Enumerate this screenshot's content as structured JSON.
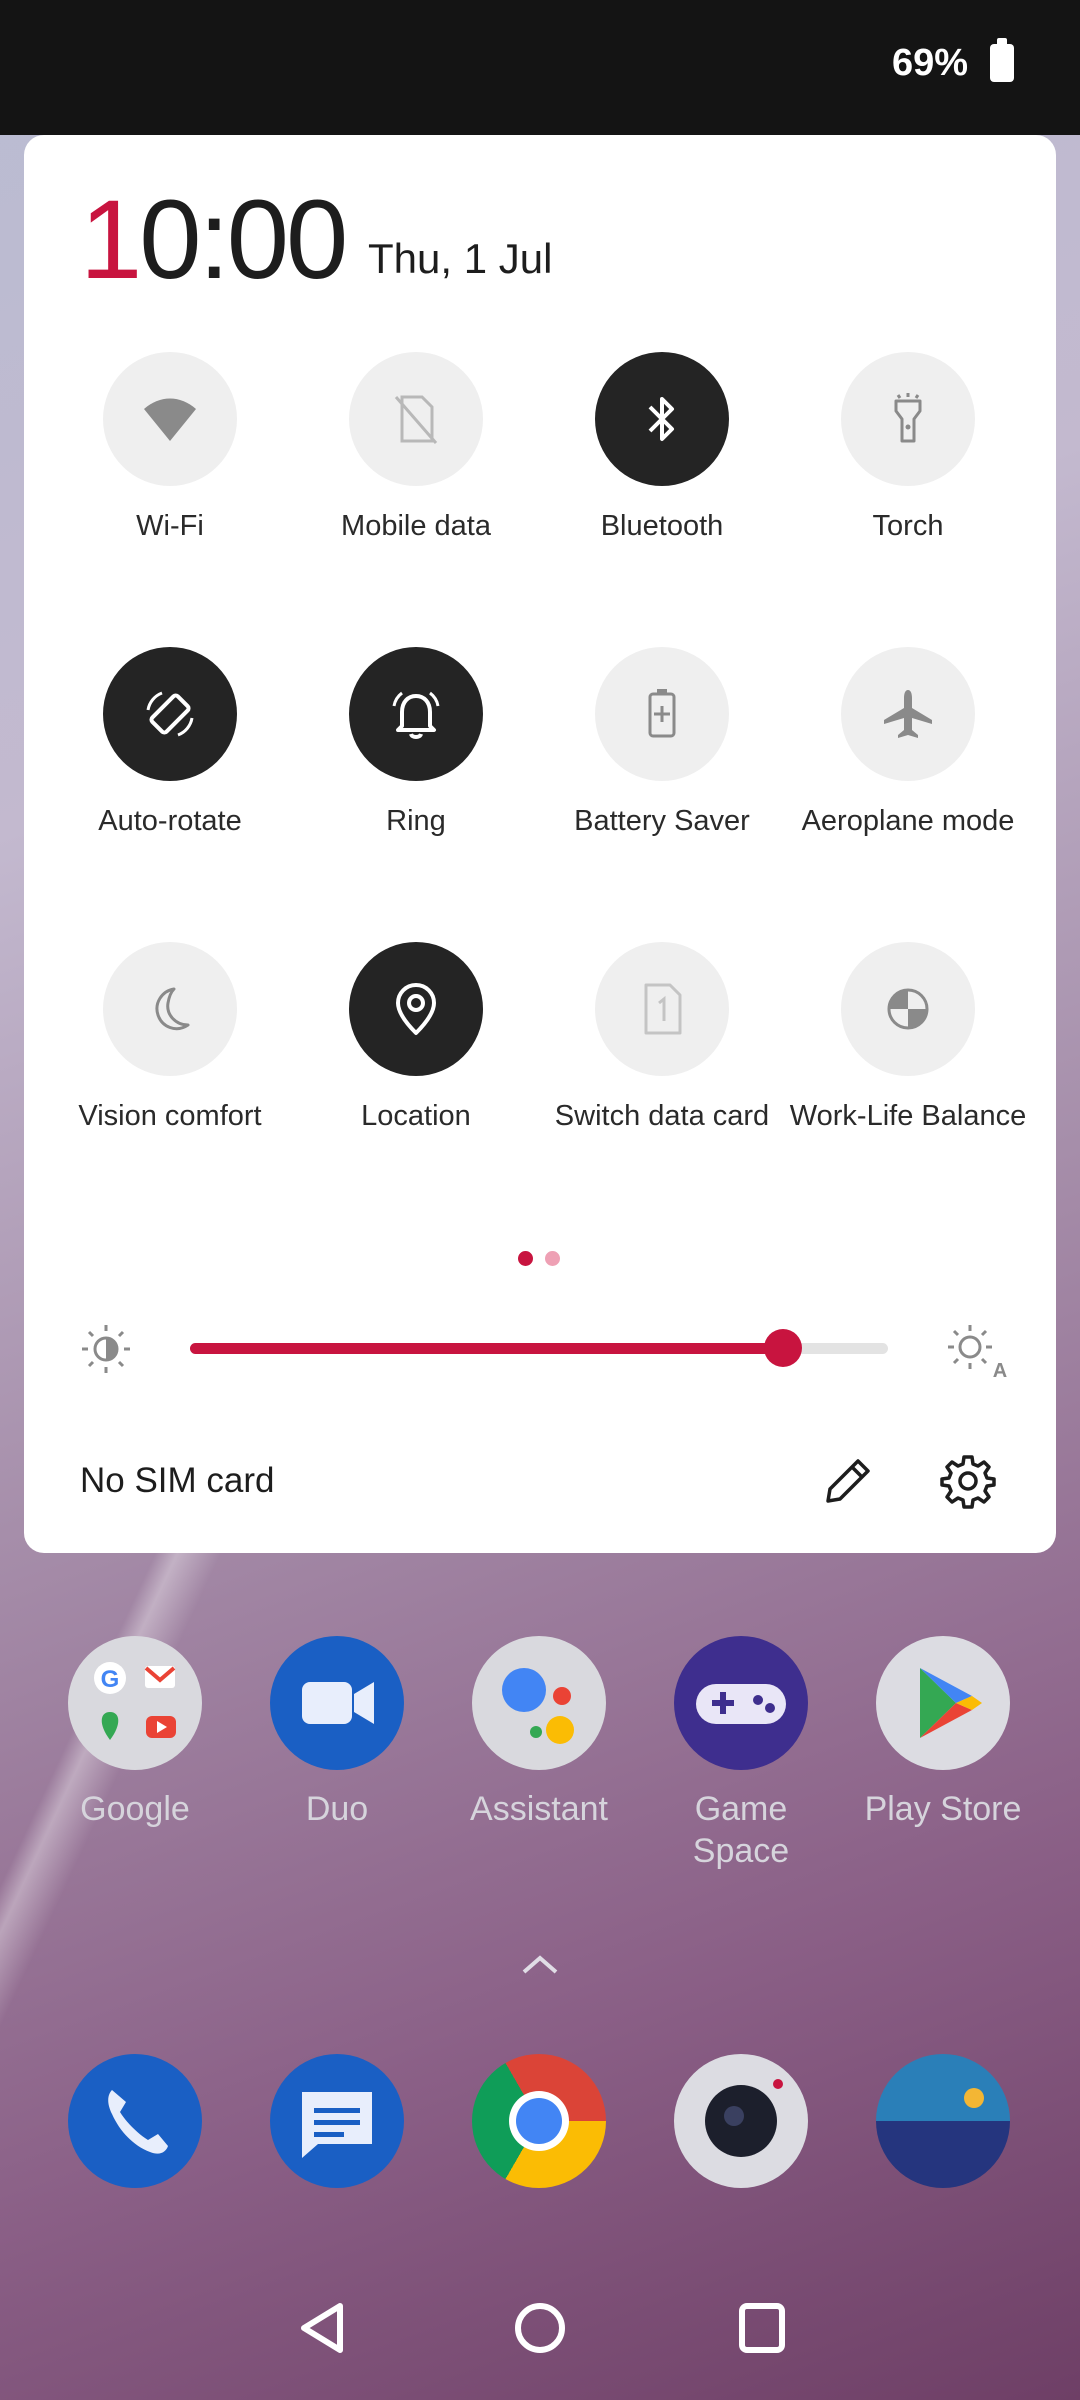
{
  "status_bar": {
    "battery_text": "69%"
  },
  "quick_settings": {
    "clock": {
      "first_digit": "1",
      "rest": "0:00"
    },
    "date": "Thu, 1 Jul",
    "tiles": [
      {
        "label": "Wi-Fi",
        "icon": "wifi-icon",
        "state": "off"
      },
      {
        "label": "Mobile data",
        "icon": "mobile-data-icon",
        "state": "off"
      },
      {
        "label": "Bluetooth",
        "icon": "bluetooth-icon",
        "state": "on"
      },
      {
        "label": "Torch",
        "icon": "torch-icon",
        "state": "off"
      },
      {
        "label": "Auto-rotate",
        "icon": "auto-rotate-icon",
        "state": "on"
      },
      {
        "label": "Ring",
        "icon": "bell-icon",
        "state": "on"
      },
      {
        "label": "Battery Saver",
        "icon": "battery-saver-icon",
        "state": "off"
      },
      {
        "label": "Aeroplane mode",
        "icon": "aeroplane-icon",
        "state": "off"
      },
      {
        "label": "Vision comfort",
        "icon": "moon-icon",
        "state": "off"
      },
      {
        "label": "Location",
        "icon": "location-icon",
        "state": "on"
      },
      {
        "label": "Switch data card",
        "icon": "sim-card-icon",
        "state": "off"
      },
      {
        "label": "Work-Life Balance",
        "icon": "work-life-icon",
        "state": "off"
      }
    ],
    "page_indicator": {
      "pages": 2,
      "current": 1
    },
    "brightness": {
      "level": 0.85
    },
    "sim_status": "No SIM card"
  },
  "home_apps": [
    {
      "label": "Google",
      "icon": "google-folder-icon"
    },
    {
      "label": "Duo",
      "icon": "duo-icon"
    },
    {
      "label": "Assistant",
      "icon": "assistant-icon"
    },
    {
      "label": "Game\nSpace",
      "icon": "game-space-icon"
    },
    {
      "label": "Play Store",
      "icon": "play-store-icon"
    }
  ],
  "dock_apps": [
    "phone-icon",
    "messages-icon",
    "chrome-icon",
    "camera-icon",
    "gallery-icon"
  ],
  "colors": {
    "accent": "#c8143f",
    "tile_on": "#242424",
    "tile_off": "#efefef"
  }
}
